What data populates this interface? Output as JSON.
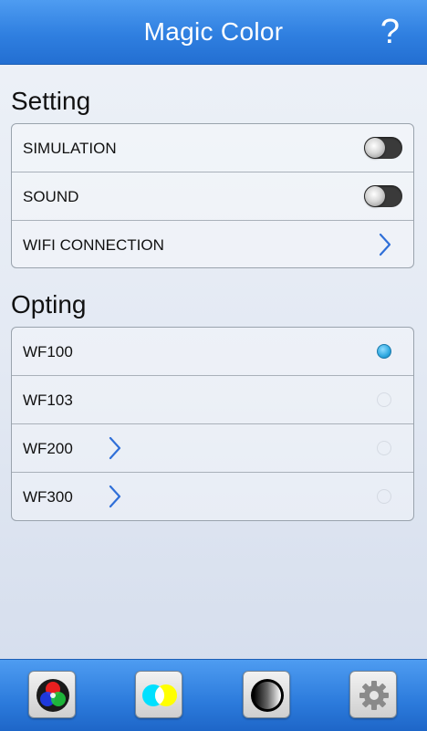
{
  "header": {
    "title": "Magic Color",
    "help_label": "?"
  },
  "setting": {
    "title": "Setting",
    "items": [
      {
        "label": "SIMULATION",
        "control": "toggle",
        "state": "off"
      },
      {
        "label": "SOUND",
        "control": "toggle",
        "state": "off"
      },
      {
        "label": "WIFI CONNECTION",
        "control": "chevron"
      }
    ]
  },
  "opting": {
    "title": "Opting",
    "items": [
      {
        "label": "WF100",
        "selected": true
      },
      {
        "label": "WF103",
        "selected": false
      },
      {
        "label": "WF200",
        "selected": false,
        "has_chevron": true
      },
      {
        "label": "WF300",
        "selected": false,
        "has_chevron": true
      }
    ]
  },
  "bottom_nav": [
    {
      "name": "rgb-color-wheel-icon"
    },
    {
      "name": "cyan-yellow-circles-icon"
    },
    {
      "name": "black-white-contrast-icon"
    },
    {
      "name": "gear-icon"
    }
  ],
  "colors": {
    "accent": "#2f7fe0",
    "radio_selected": "#2ea8e0",
    "chevron": "#2f6fd8"
  }
}
